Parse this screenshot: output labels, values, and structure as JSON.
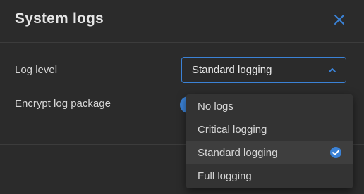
{
  "dialog": {
    "title": "System logs",
    "close_icon": "close-icon"
  },
  "colors": {
    "accent": "#3b82d6",
    "background": "#2b2b2b",
    "menu_background": "#333333",
    "text": "#d6d6d6"
  },
  "settings": {
    "log_level": {
      "label": "Log level",
      "value": "Standard logging",
      "icon": "chevron-up-icon"
    },
    "encrypt": {
      "label": "Encrypt log package"
    }
  },
  "dropdown": {
    "options": [
      {
        "label": "No logs",
        "selected": false
      },
      {
        "label": "Critical logging",
        "selected": false
      },
      {
        "label": "Standard logging",
        "selected": true
      },
      {
        "label": "Full logging",
        "selected": false
      }
    ],
    "selected_icon": "check-circle-icon"
  }
}
